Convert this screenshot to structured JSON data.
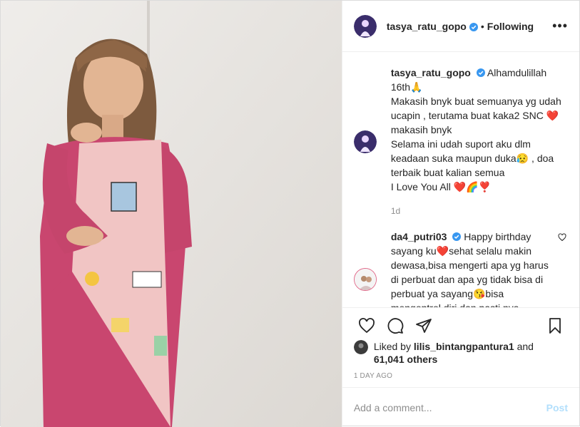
{
  "header": {
    "username": "tasya_ratu_gopo",
    "separator": "•",
    "follow_status": "Following",
    "more_label": "•••"
  },
  "caption": {
    "username": "tasya_ratu_gopo",
    "lines": [
      "Alhamdulillah 16th🙏",
      "Makasih bnyk buat semuanya yg udah ucapin , terutama buat kaka2 SNC ❤️ makasih bnyk",
      "Selama ini udah suport aku dlm keadaan suka maupun duka😥 , doa terbaik buat kalian semua",
      "I Love You All ❤️🌈❣️"
    ],
    "age": "1d"
  },
  "comment": {
    "username": "da4_putri03",
    "text": "Happy birthday sayang ku❤️sehat selalu makin dewasa,bisa mengerti apa yg harus di perbuat dan apa yg tidak bisa di perbuat ya sayang😘bisa mengontrol diri,dan pasti nya semoga selalu ingat sama Allah"
  },
  "likes": {
    "prefix": "Liked by",
    "user": "lilis_bintangpantura1",
    "conjunction": "and",
    "others": "61,041 others"
  },
  "timestamp": "1 DAY AGO",
  "add_comment": {
    "placeholder": "Add a comment...",
    "post_label": "Post"
  },
  "icons": {
    "like": "heart-icon",
    "comment": "comment-icon",
    "share": "share-icon",
    "save": "bookmark-icon",
    "verified": "verified-badge-icon"
  },
  "colors": {
    "verified": "#3897f0",
    "post_disabled": "#b2dffc",
    "meta_gray": "#8e8e8e"
  }
}
